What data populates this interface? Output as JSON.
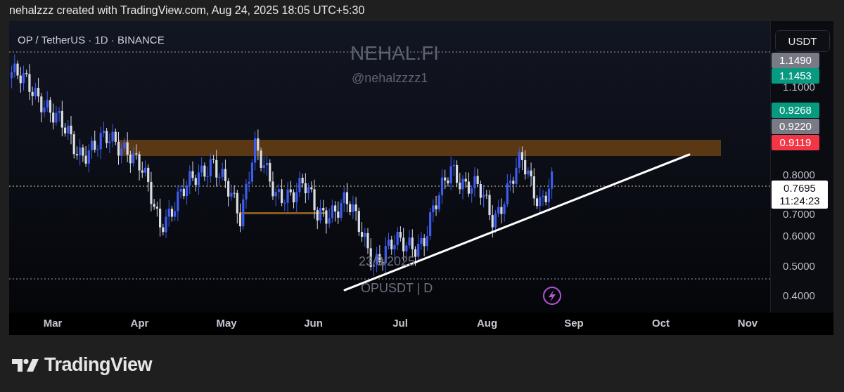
{
  "header": {
    "text": "nehalzzz created with TradingView.com, Aug 24, 2025 18:05 UTC+5:30"
  },
  "chart": {
    "symbol": "OP / TetherUS · 1D · BINANCE",
    "watermarks": [
      {
        "kind": "title",
        "text": "NEHAL.FI"
      },
      {
        "kind": "handle",
        "text": "@nehalzzzz1"
      },
      {
        "kind": "date",
        "text": "23/8/2025"
      },
      {
        "kind": "symbol",
        "text": "OPUSDT | D"
      }
    ],
    "currency_button": "USDT",
    "price_tags": [
      {
        "text": "1.1490",
        "color": "#787b86"
      },
      {
        "text": "1.1453",
        "color": "#089981"
      },
      {
        "text": "0.9268",
        "color": "#089981"
      },
      {
        "text": "0.9220",
        "color": "#787b86"
      },
      {
        "text": "0.9119",
        "color": "#f23645"
      }
    ],
    "price_ticks": [
      "1.1000",
      "0.8000",
      "0.7000",
      "0.6000",
      "0.5000",
      "0.4000"
    ],
    "current_price": {
      "price": "0.7695",
      "countdown": "11:24:23"
    },
    "time_ticks": [
      "Mar",
      "Apr",
      "May",
      "Jun",
      "Jul",
      "Aug",
      "Sep",
      "Oct",
      "Nov"
    ]
  },
  "footer": {
    "logo": "TradingView"
  }
}
